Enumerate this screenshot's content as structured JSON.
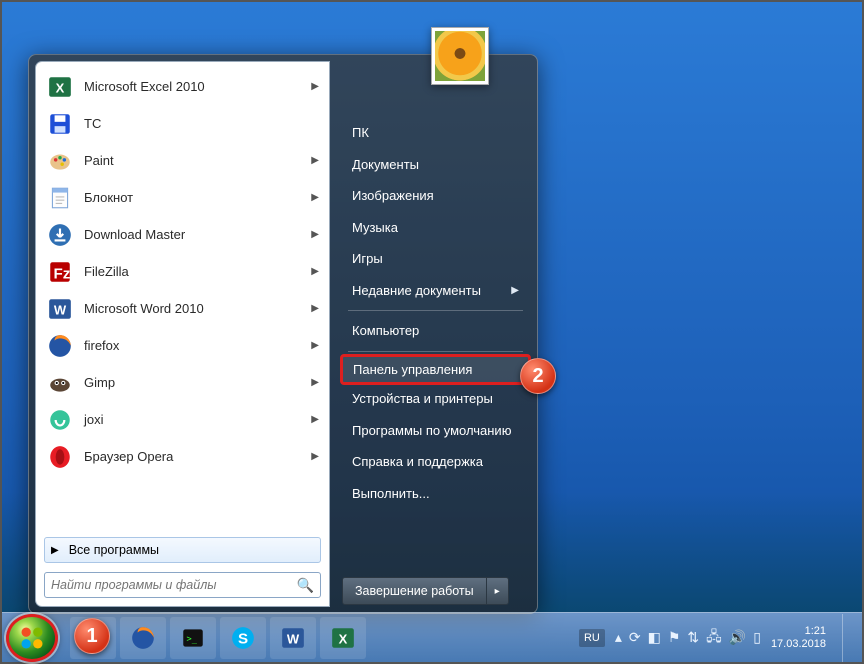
{
  "start_menu": {
    "programs": [
      {
        "label": "Microsoft Excel 2010",
        "icon": "excel",
        "submenu": true
      },
      {
        "label": "TC",
        "icon": "save",
        "submenu": false
      },
      {
        "label": "Paint",
        "icon": "paint",
        "submenu": true
      },
      {
        "label": "Блокнот",
        "icon": "notepad",
        "submenu": true
      },
      {
        "label": "Download Master",
        "icon": "download-master",
        "submenu": true
      },
      {
        "label": "FileZilla",
        "icon": "filezilla",
        "submenu": true
      },
      {
        "label": "Microsoft Word 2010",
        "icon": "word",
        "submenu": true
      },
      {
        "label": "firefox",
        "icon": "firefox",
        "submenu": true
      },
      {
        "label": "Gimp",
        "icon": "gimp",
        "submenu": true
      },
      {
        "label": "joxi",
        "icon": "joxi",
        "submenu": true
      },
      {
        "label": "Браузер Opera",
        "icon": "opera",
        "submenu": true
      }
    ],
    "all_programs_label": "Все программы",
    "search_placeholder": "Найти программы и файлы",
    "right": {
      "items_top": [
        "ПК",
        "Документы",
        "Изображения",
        "Музыка",
        "Игры"
      ],
      "recent_documents": "Недавние документы",
      "computer": "Компьютер",
      "control_panel": "Панель управления",
      "items_bottom": [
        "Устройства и принтеры",
        "Программы по умолчанию",
        "Справка и поддержка",
        "Выполнить..."
      ],
      "shutdown": "Завершение работы"
    }
  },
  "taskbar": {
    "lang": "RU",
    "time": "1:21",
    "date": "17.03.2018"
  },
  "annotations": {
    "one": "1",
    "two": "2"
  }
}
